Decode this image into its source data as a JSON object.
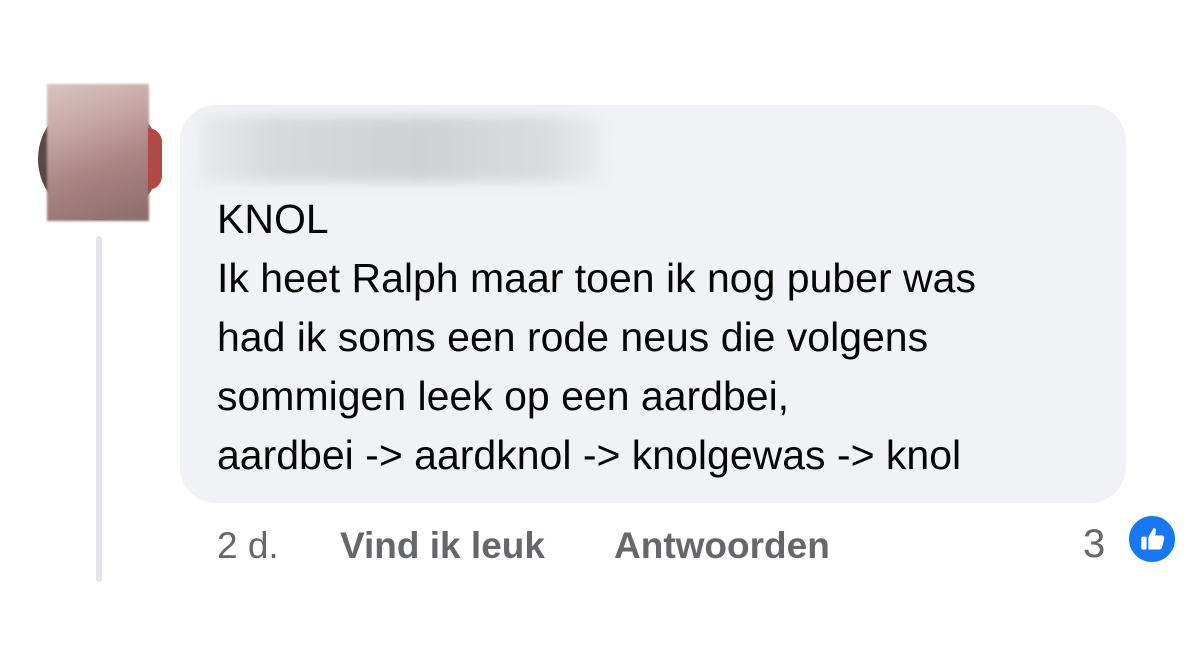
{
  "comment": {
    "lines": [
      "KNOL",
      "Ik heet Ralph maar toen ik nog puber was",
      "had ik soms een rode neus die volgens",
      "sommigen leek op een aardbei,",
      "aardbei -> aardknol -> knolgewas -> knol"
    ]
  },
  "footer": {
    "time": "2 d.",
    "like_label": "Vind ik leuk",
    "reply_label": "Antwoorden",
    "reaction_count": "3"
  },
  "icons": {
    "reaction": "thumbs-up-icon"
  },
  "colors": {
    "bubble": "#f0f2f5",
    "text": "#050505",
    "meta": "#65676b",
    "like_blue": "#1877f2"
  }
}
